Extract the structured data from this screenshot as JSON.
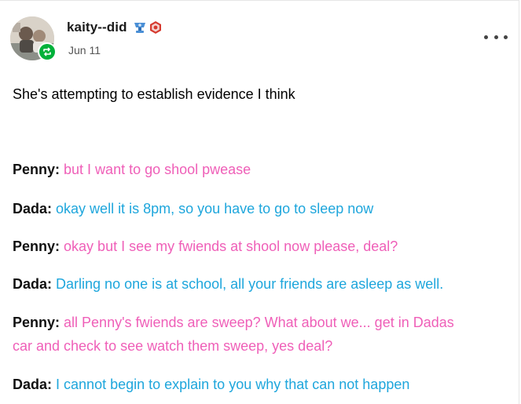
{
  "post": {
    "blog_name": "kaity--did",
    "date": "Jun 11",
    "intro": "She's attempting to establish evidence I think",
    "colors": {
      "penny": "#ef5fb8",
      "dada": "#1ea6dc",
      "reblog_badge": "#00b13a"
    },
    "icons": {
      "reblog_badge": "reblog-icon",
      "more": "more-options-icon",
      "badge_1": "trophy-badge-icon",
      "badge_2": "hexagon-badge-icon"
    },
    "dialogue": [
      {
        "speaker": "Penny:",
        "text": "but I want to go shool pwease",
        "color": "pink"
      },
      {
        "speaker": "Dada:",
        "text": "okay well it is 8pm, so you have to go to sleep now",
        "color": "blue"
      },
      {
        "speaker": "Penny:",
        "text": "okay but I see my fwiends at shool now please, deal?",
        "color": "pink"
      },
      {
        "speaker": "Dada:",
        "text": "Darling no one is at school, all your friends are asleep as well.",
        "color": "blue"
      },
      {
        "speaker": "Penny:",
        "text": "all Penny's fwiends are sweep? What about we... get in Dadas",
        "text_2": "car and check to see watch them sweep, yes deal?",
        "color": "pink"
      },
      {
        "speaker": "Dada:",
        "text": "I cannot begin to explain to you why that can not happen",
        "color": "blue"
      }
    ]
  }
}
